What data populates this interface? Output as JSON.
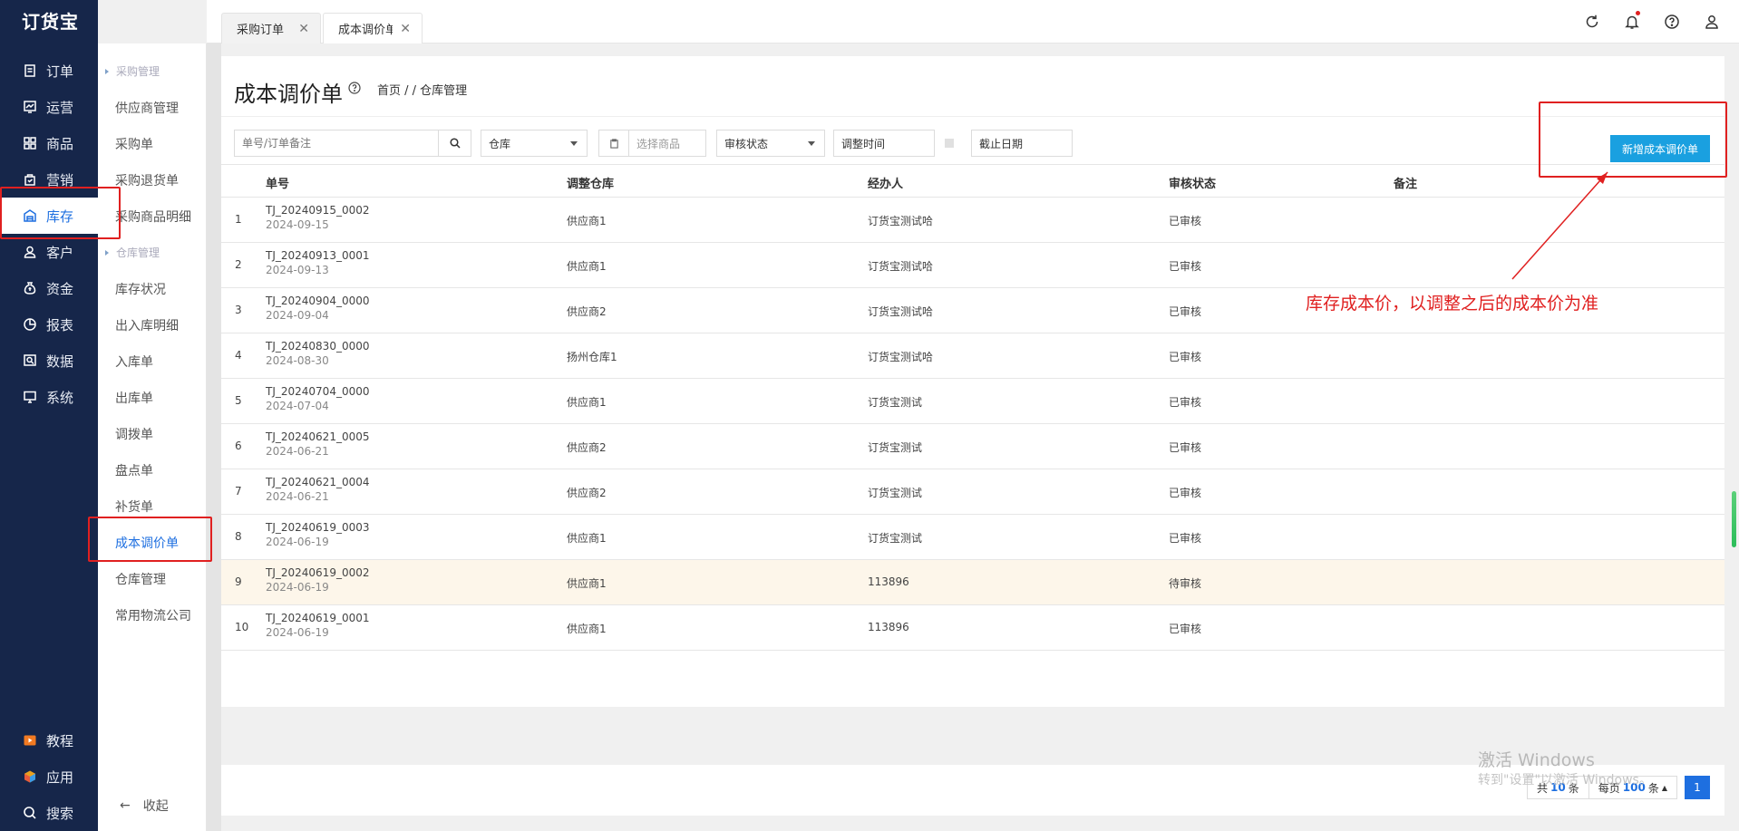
{
  "app": {
    "logo": "订货宝"
  },
  "nav": {
    "items": [
      {
        "label": "订单",
        "icon": "order-icon"
      },
      {
        "label": "运营",
        "icon": "operation-icon"
      },
      {
        "label": "商品",
        "icon": "product-icon"
      },
      {
        "label": "营销",
        "icon": "marketing-icon"
      },
      {
        "label": "库存",
        "icon": "warehouse-icon",
        "active": true
      },
      {
        "label": "客户",
        "icon": "customer-icon"
      },
      {
        "label": "资金",
        "icon": "money-icon"
      },
      {
        "label": "报表",
        "icon": "report-icon"
      },
      {
        "label": "数据",
        "icon": "data-icon"
      },
      {
        "label": "系统",
        "icon": "system-icon"
      }
    ],
    "bottom": [
      {
        "label": "教程",
        "icon": "tutorial-icon"
      },
      {
        "label": "应用",
        "icon": "apps-icon"
      },
      {
        "label": "搜索",
        "icon": "search-icon"
      }
    ]
  },
  "subnav": {
    "group1": "采购管理",
    "group1_items": [
      "供应商管理",
      "采购单",
      "采购退货单",
      "采购商品明细"
    ],
    "group2": "仓库管理",
    "group2_items": [
      "库存状况",
      "出入库明细",
      "入库单",
      "出库单",
      "调拨单",
      "盘点单",
      "补货单",
      "成本调价单",
      "仓库管理",
      "常用物流公司"
    ],
    "collapse": "收起"
  },
  "tabs": [
    {
      "label": "采购订单"
    },
    {
      "label": "成本调价单"
    }
  ],
  "page": {
    "title": "成本调价单",
    "breadcrumb": "首页 / / 仓库管理"
  },
  "filters": {
    "search_placeholder": "单号/订单备注",
    "warehouse": "仓库",
    "product_placeholder": "选择商品",
    "audit_status": "审核状态",
    "adjust_time": "调整时间",
    "end_date": "截止日期",
    "new_button": "新增成本调价单"
  },
  "table": {
    "headers": [
      "单号",
      "调整仓库",
      "经办人",
      "审核状态",
      "备注"
    ],
    "rows": [
      {
        "idx": "1",
        "no": "TJ_20240915_0002",
        "date": "2024-09-15",
        "warehouse": "供应商1",
        "handler": "订货宝测试哈",
        "status": "已审核"
      },
      {
        "idx": "2",
        "no": "TJ_20240913_0001",
        "date": "2024-09-13",
        "warehouse": "供应商1",
        "handler": "订货宝测试哈",
        "status": "已审核"
      },
      {
        "idx": "3",
        "no": "TJ_20240904_0000",
        "date": "2024-09-04",
        "warehouse": "供应商2",
        "handler": "订货宝测试哈",
        "status": "已审核"
      },
      {
        "idx": "4",
        "no": "TJ_20240830_0000",
        "date": "2024-08-30",
        "warehouse": "扬州仓库1",
        "handler": "订货宝测试哈",
        "status": "已审核"
      },
      {
        "idx": "5",
        "no": "TJ_20240704_0000",
        "date": "2024-07-04",
        "warehouse": "供应商1",
        "handler": "订货宝测试",
        "status": "已审核"
      },
      {
        "idx": "6",
        "no": "TJ_20240621_0005",
        "date": "2024-06-21",
        "warehouse": "供应商2",
        "handler": "订货宝测试",
        "status": "已审核"
      },
      {
        "idx": "7",
        "no": "TJ_20240621_0004",
        "date": "2024-06-21",
        "warehouse": "供应商2",
        "handler": "订货宝测试",
        "status": "已审核"
      },
      {
        "idx": "8",
        "no": "TJ_20240619_0003",
        "date": "2024-06-19",
        "warehouse": "供应商1",
        "handler": "订货宝测试",
        "status": "已审核"
      },
      {
        "idx": "9",
        "no": "TJ_20240619_0002",
        "date": "2024-06-19",
        "warehouse": "供应商1",
        "handler": "113896",
        "status": "待审核",
        "highlight": true
      },
      {
        "idx": "10",
        "no": "TJ_20240619_0001",
        "date": "2024-06-19",
        "warehouse": "供应商1",
        "handler": "113896",
        "status": "已审核"
      }
    ]
  },
  "pager": {
    "total_prefix": "共",
    "total": "10",
    "total_suffix": "条",
    "per_prefix": "每页",
    "per": "100",
    "per_suffix": "条",
    "current": "1"
  },
  "annotation": {
    "text": "库存成本价，以调整之后的成本价为准"
  },
  "watermark": {
    "line1": "激活 Windows",
    "line2": "转到\"设置\"以激活 Windows。"
  },
  "colors": {
    "accent": "#1e6fe0",
    "nav_bg": "#16264a",
    "annotation": "#e02020",
    "button": "#1aa0e0"
  }
}
